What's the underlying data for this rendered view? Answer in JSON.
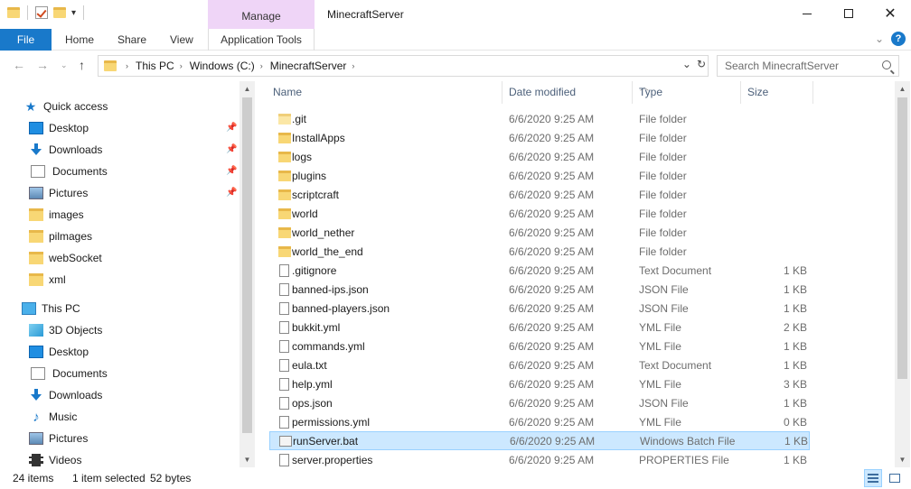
{
  "window": {
    "title": "MinecraftServer",
    "context_tab_header": "Manage",
    "colors": {
      "accent": "#1979ca",
      "context_tab": "#efd5f7",
      "selection": "#cce8ff"
    }
  },
  "ribbon": {
    "tabs": [
      "File",
      "Home",
      "Share",
      "View"
    ],
    "context_tab": "Application Tools"
  },
  "address": {
    "crumbs": [
      "This PC",
      "Windows (C:)",
      "MinecraftServer"
    ],
    "search_placeholder": "Search MinecraftServer"
  },
  "nav": {
    "quick_access": "Quick access",
    "quick_items": [
      {
        "label": "Desktop",
        "icon": "desktop-icon",
        "pinned": true
      },
      {
        "label": "Downloads",
        "icon": "downloads-icon",
        "pinned": true
      },
      {
        "label": "Documents",
        "icon": "documents-icon",
        "pinned": true
      },
      {
        "label": "Pictures",
        "icon": "pictures-icon",
        "pinned": true
      },
      {
        "label": "images",
        "icon": "folder-icon",
        "pinned": false
      },
      {
        "label": "pilmages",
        "icon": "folder-icon",
        "pinned": false
      },
      {
        "label": "webSocket",
        "icon": "folder-icon",
        "pinned": false
      },
      {
        "label": "xml",
        "icon": "folder-icon",
        "pinned": false
      }
    ],
    "this_pc": "This PC",
    "pc_items": [
      {
        "label": "3D Objects",
        "icon": "3d-objects-icon"
      },
      {
        "label": "Desktop",
        "icon": "desktop-icon"
      },
      {
        "label": "Documents",
        "icon": "documents-icon"
      },
      {
        "label": "Downloads",
        "icon": "downloads-icon"
      },
      {
        "label": "Music",
        "icon": "music-icon"
      },
      {
        "label": "Pictures",
        "icon": "pictures-icon"
      },
      {
        "label": "Videos",
        "icon": "videos-icon"
      }
    ]
  },
  "columns": {
    "name": "Name",
    "date": "Date modified",
    "type": "Type",
    "size": "Size"
  },
  "files": [
    {
      "name": ".git",
      "date": "6/6/2020 9:25 AM",
      "type": "File folder",
      "size": "",
      "kind": "folder-git"
    },
    {
      "name": "InstallApps",
      "date": "6/6/2020 9:25 AM",
      "type": "File folder",
      "size": "",
      "kind": "folder"
    },
    {
      "name": "logs",
      "date": "6/6/2020 9:25 AM",
      "type": "File folder",
      "size": "",
      "kind": "folder"
    },
    {
      "name": "plugins",
      "date": "6/6/2020 9:25 AM",
      "type": "File folder",
      "size": "",
      "kind": "folder"
    },
    {
      "name": "scriptcraft",
      "date": "6/6/2020 9:25 AM",
      "type": "File folder",
      "size": "",
      "kind": "folder"
    },
    {
      "name": "world",
      "date": "6/6/2020 9:25 AM",
      "type": "File folder",
      "size": "",
      "kind": "folder"
    },
    {
      "name": "world_nether",
      "date": "6/6/2020 9:25 AM",
      "type": "File folder",
      "size": "",
      "kind": "folder"
    },
    {
      "name": "world_the_end",
      "date": "6/6/2020 9:25 AM",
      "type": "File folder",
      "size": "",
      "kind": "folder"
    },
    {
      "name": ".gitignore",
      "date": "6/6/2020 9:25 AM",
      "type": "Text Document",
      "size": "1 KB",
      "kind": "file"
    },
    {
      "name": "banned-ips.json",
      "date": "6/6/2020 9:25 AM",
      "type": "JSON File",
      "size": "1 KB",
      "kind": "file"
    },
    {
      "name": "banned-players.json",
      "date": "6/6/2020 9:25 AM",
      "type": "JSON File",
      "size": "1 KB",
      "kind": "file"
    },
    {
      "name": "bukkit.yml",
      "date": "6/6/2020 9:25 AM",
      "type": "YML File",
      "size": "2 KB",
      "kind": "file"
    },
    {
      "name": "commands.yml",
      "date": "6/6/2020 9:25 AM",
      "type": "YML File",
      "size": "1 KB",
      "kind": "file"
    },
    {
      "name": "eula.txt",
      "date": "6/6/2020 9:25 AM",
      "type": "Text Document",
      "size": "1 KB",
      "kind": "file"
    },
    {
      "name": "help.yml",
      "date": "6/6/2020 9:25 AM",
      "type": "YML File",
      "size": "3 KB",
      "kind": "file"
    },
    {
      "name": "ops.json",
      "date": "6/6/2020 9:25 AM",
      "type": "JSON File",
      "size": "1 KB",
      "kind": "file"
    },
    {
      "name": "permissions.yml",
      "date": "6/6/2020 9:25 AM",
      "type": "YML File",
      "size": "0 KB",
      "kind": "file"
    },
    {
      "name": "runServer.bat",
      "date": "6/6/2020 9:25 AM",
      "type": "Windows Batch File",
      "size": "1 KB",
      "kind": "bat",
      "selected": true
    },
    {
      "name": "server.properties",
      "date": "6/6/2020 9:25 AM",
      "type": "PROPERTIES File",
      "size": "1 KB",
      "kind": "file"
    }
  ],
  "status": {
    "item_count": "24 items",
    "selection": "1 item selected",
    "selection_size": "52 bytes"
  }
}
